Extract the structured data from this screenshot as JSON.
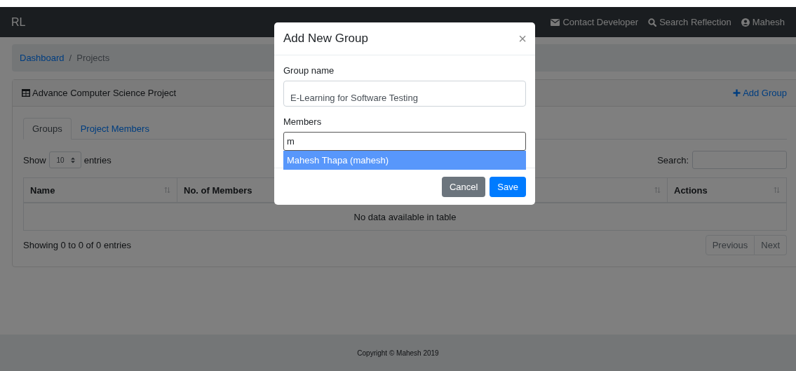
{
  "navbar": {
    "brand": "RL",
    "links": [
      {
        "kind": "envelope",
        "label": "Contact Developer"
      },
      {
        "kind": "search",
        "label": "Search Reflection"
      },
      {
        "kind": "user",
        "label": "Mahesh"
      }
    ]
  },
  "breadcrumb": {
    "separator": "/",
    "items": [
      {
        "label": "Dashboard",
        "link": true
      },
      {
        "label": "Projects",
        "link": false
      }
    ]
  },
  "card": {
    "title": "Advance Computer Science Project",
    "action": "Add Group",
    "tabs": [
      {
        "label": "Groups",
        "selected": true
      },
      {
        "label": "Project Members",
        "selected": false
      }
    ],
    "length_menu": {
      "before": "Show",
      "value": "10",
      "after": "entries"
    },
    "search": {
      "label": "Search:"
    },
    "table": {
      "columns": [
        {
          "label": "Name",
          "sortable": true
        },
        {
          "label": "No. of Members"
        },
        {
          "sortable": true
        },
        {
          "label": "Actions",
          "sortable": true
        }
      ],
      "empty_message": "No data available in table"
    },
    "info": "Showing 0 to 0 of 0 entries",
    "pagination": [
      {
        "label": "Previous",
        "disabled": true
      },
      {
        "label": "Next",
        "disabled": true
      }
    ]
  },
  "footer": {
    "text": "Copyright © Mahesh 2019"
  },
  "modal": {
    "title": "Add New Group",
    "close": "×",
    "fields": [
      {
        "label": "Group name",
        "value": "E-Learning for Software Testing",
        "focused": false
      },
      {
        "label": "Members",
        "value": "m",
        "focused": true,
        "suggestions": [
          {
            "label": "Mahesh Thapa (mahesh)",
            "selected": true
          }
        ]
      }
    ],
    "buttons": [
      {
        "kind": "secondary",
        "label": "Cancel"
      },
      {
        "kind": "primary",
        "label": "Save"
      }
    ]
  }
}
